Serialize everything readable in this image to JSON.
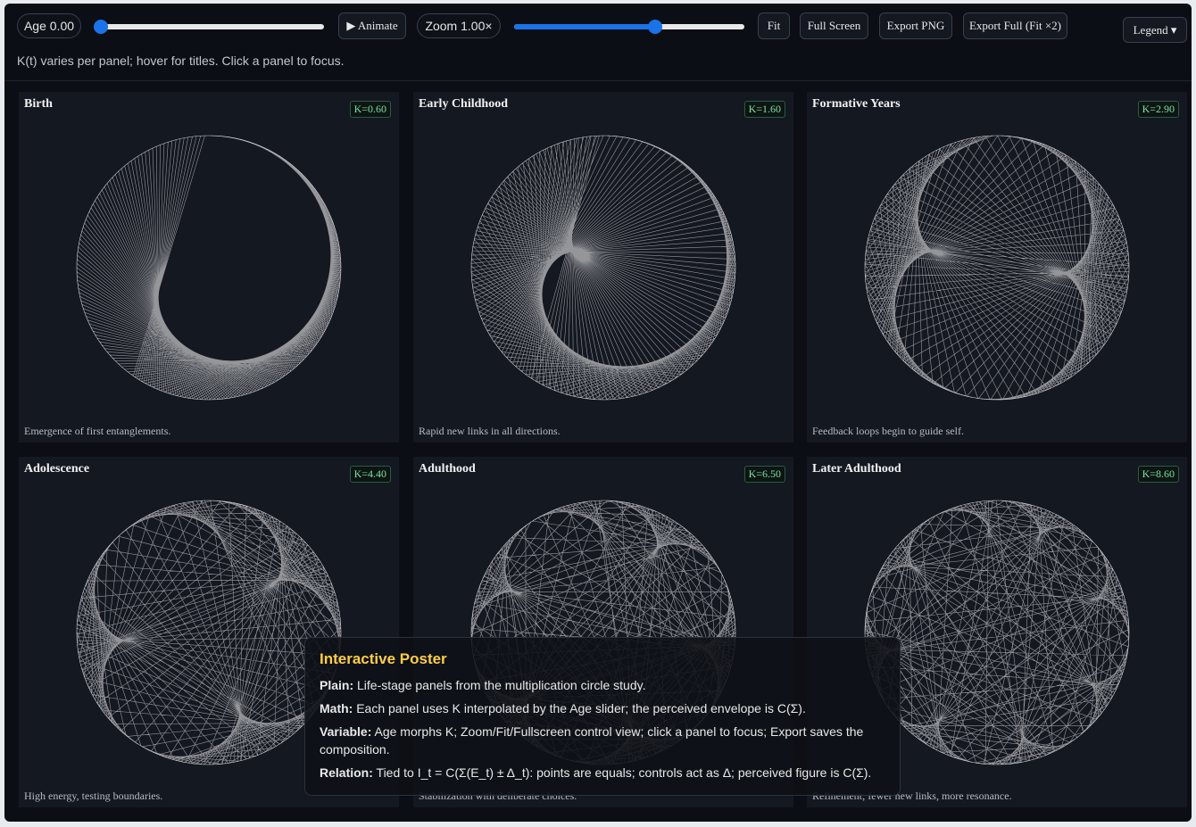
{
  "toolbar": {
    "age_label": "Age 0.00",
    "age_value": 0,
    "animate_label": "▶ Animate",
    "zoom_label": "Zoom 1.00×",
    "zoom_fraction": 0.62,
    "fit_label": "Fit",
    "fullscreen_label": "Full Screen",
    "export_png_label": "Export PNG",
    "export_full_label": "Export Full (Fit ×2)",
    "legend_label": "Legend ▾"
  },
  "hint": "K(t) varies per panel; hover for titles. Click a panel to focus.",
  "panels": [
    {
      "title": "Birth",
      "k_label": "K=0.60",
      "k": 0.6,
      "caption": "Emergence of first entanglements."
    },
    {
      "title": "Early Childhood",
      "k_label": "K=1.60",
      "k": 1.6,
      "caption": "Rapid new links in all directions."
    },
    {
      "title": "Formative Years",
      "k_label": "K=2.90",
      "k": 2.9,
      "caption": "Feedback loops begin to guide self."
    },
    {
      "title": "Adolescence",
      "k_label": "K=4.40",
      "k": 4.4,
      "caption": "High energy, testing boundaries."
    },
    {
      "title": "Adulthood",
      "k_label": "K=6.50",
      "k": 6.5,
      "caption": "Stabilization with deliberate choices."
    },
    {
      "title": "Later Adulthood",
      "k_label": "K=8.60",
      "k": 8.6,
      "caption": "Refinement; fewer new links, more resonance."
    }
  ],
  "legend": {
    "heading": "Interactive Poster",
    "plain_key": "Plain:",
    "plain": "Life-stage panels from the multiplication circle study.",
    "math_key": "Math:",
    "math": "Each panel uses K interpolated by the Age slider; the perceived envelope is C(Σ).",
    "variable_key": "Variable:",
    "variable": "Age morphs K; Zoom/Fit/Fullscreen control view; click a panel to focus; Export saves the composition.",
    "relation_key": "Relation:",
    "relation": "Tied to I_t = C(Σ(E_t) ± Δ_t): points are equals; controls act as Δ; perceived figure is C(Σ)."
  },
  "colors": {
    "accent": "#1a73e8",
    "legend_heading": "#ffce4a",
    "k_badge": "#7be0a8",
    "line": "#ffffff"
  }
}
